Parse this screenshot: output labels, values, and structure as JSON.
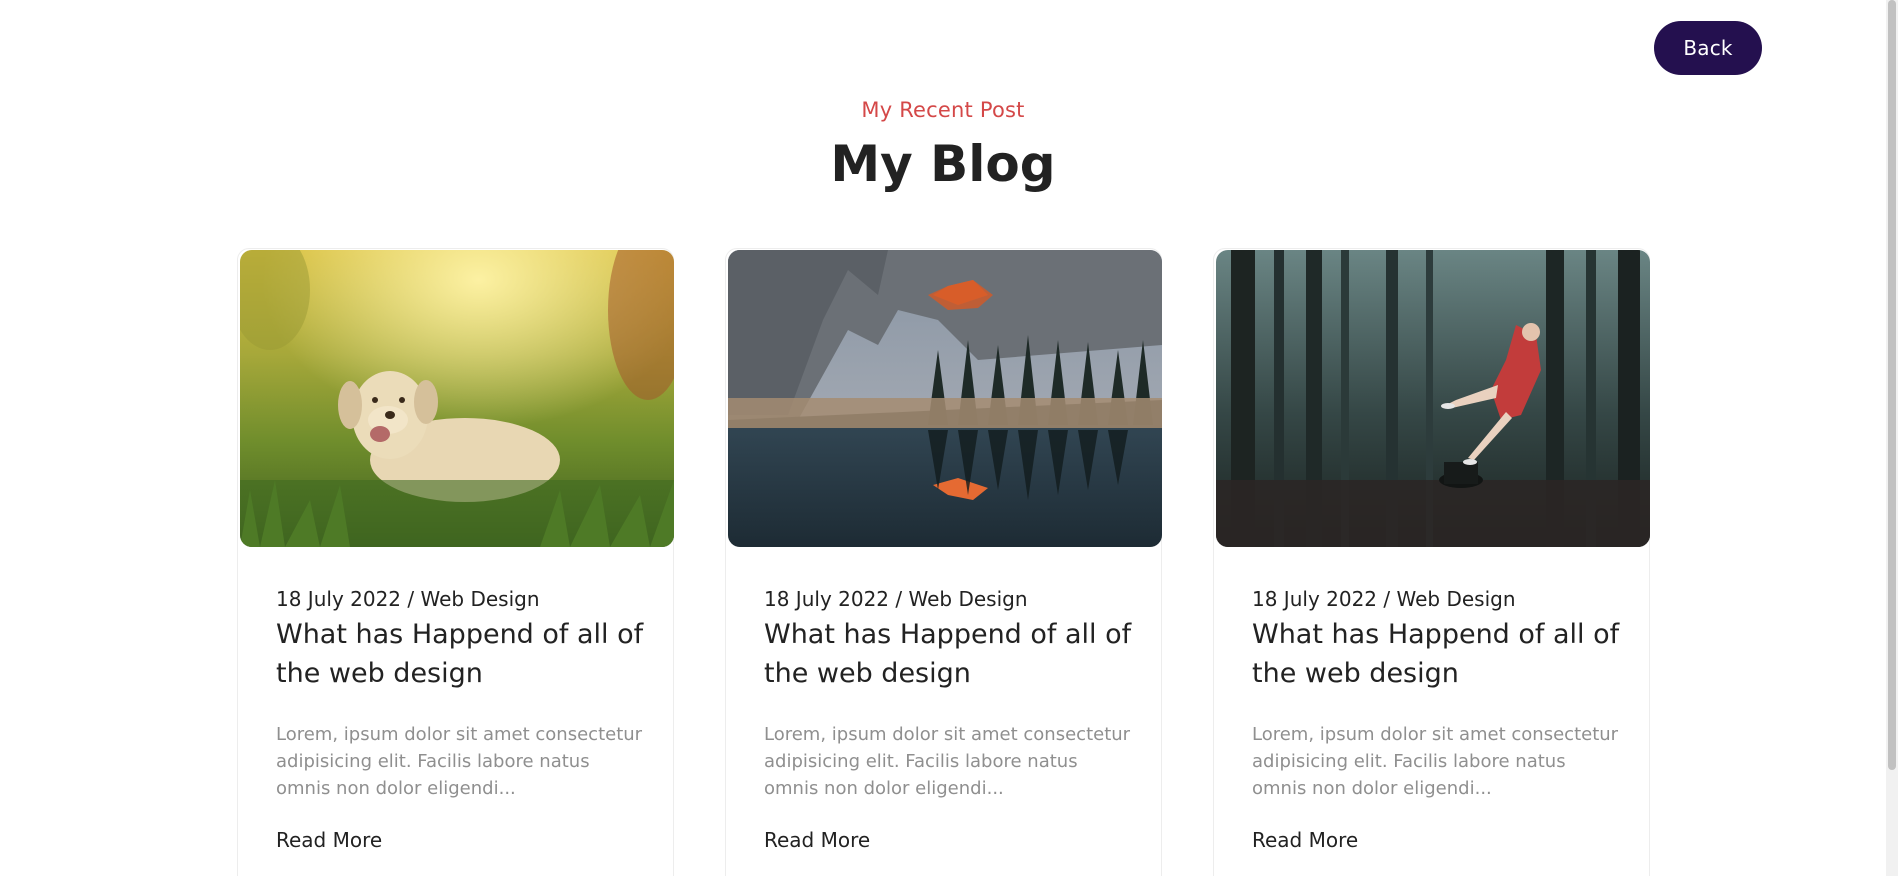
{
  "header": {
    "back_label": "Back"
  },
  "section": {
    "subtitle": "My Recent Post",
    "title": "My Blog"
  },
  "posts": [
    {
      "image": "dog-in-grass-photo",
      "meta": "18 July 2022 / Web Design",
      "title": "What has Happend of all of the web design",
      "excerpt": "Lorem, ipsum dolor sit amet consectetur adipisicing elit. Facilis labore natus omnis non dolor eligendi...",
      "read_more": "Read More"
    },
    {
      "image": "mountain-lake-reflection-photo",
      "meta": "18 July 2022 / Web Design",
      "title": "What has Happend of all of the web design",
      "excerpt": "Lorem, ipsum dolor sit amet consectetur adipisicing elit. Facilis labore natus omnis non dolor eligendi...",
      "read_more": "Read More"
    },
    {
      "image": "woman-in-forest-photo",
      "meta": "18 July 2022 / Web Design",
      "title": "What has Happend of all of the web design",
      "excerpt": "Lorem, ipsum dolor sit amet consectetur adipisicing elit. Facilis labore natus omnis non dolor eligendi...",
      "read_more": "Read More"
    }
  ],
  "colors": {
    "accent": "#d44848",
    "button": "#24104f",
    "text": "#222222",
    "muted": "#8f8f8f"
  }
}
